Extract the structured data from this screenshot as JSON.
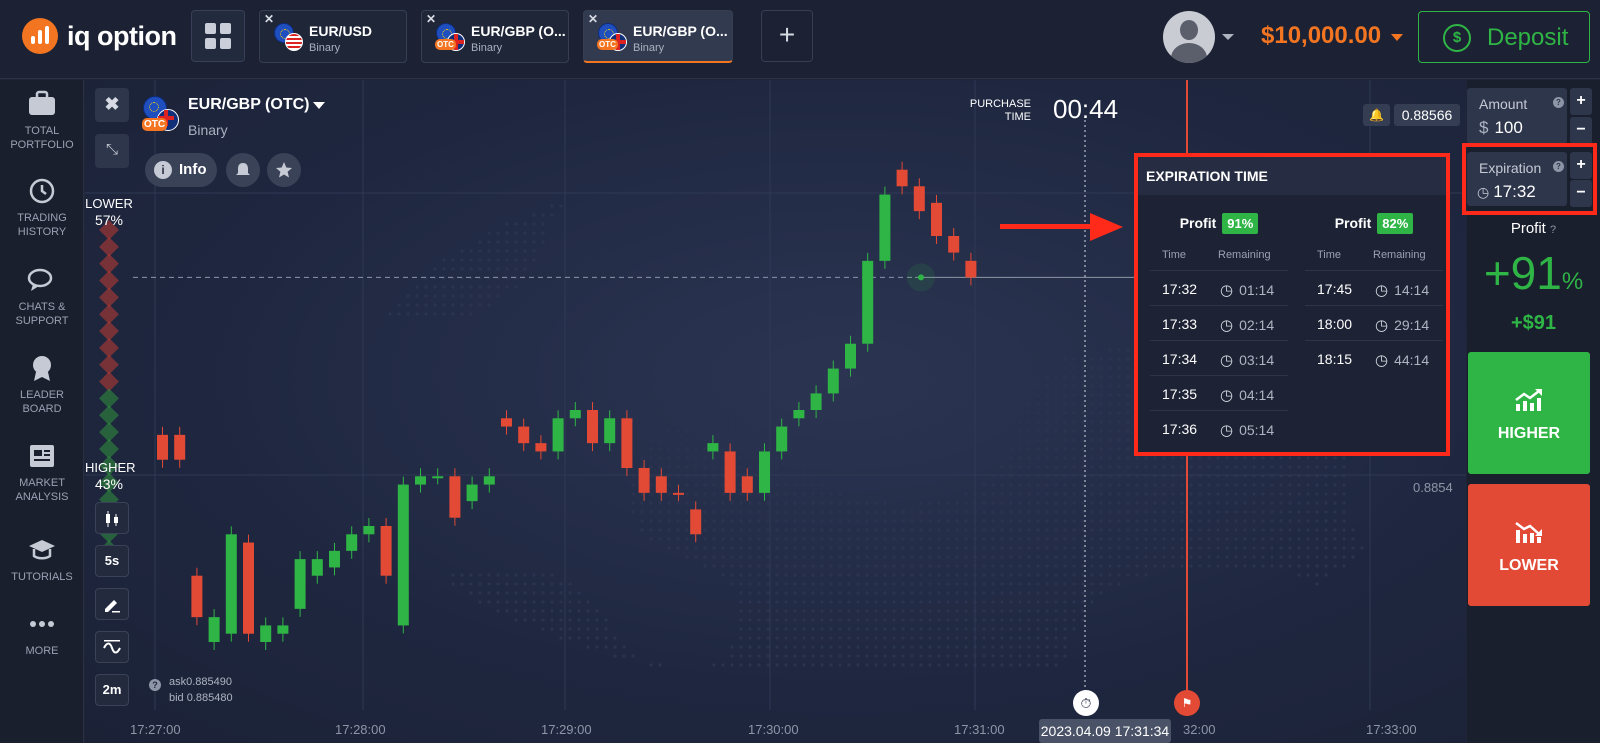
{
  "app": {
    "brand": "iq option"
  },
  "header": {
    "tabs": [
      {
        "name": "EUR/USD",
        "type": "Binary",
        "flag": "eu-us"
      },
      {
        "name": "EUR/GBP (O...",
        "type": "Binary",
        "flag": "eu-uk-otc"
      },
      {
        "name": "EUR/GBP (O...",
        "type": "Binary",
        "flag": "eu-uk-otc",
        "active": true
      }
    ],
    "otc_badge": "OTC",
    "balance": "$10,000.00",
    "deposit_label": "Deposit",
    "add_tab": "+",
    "deposit_icon": "$"
  },
  "sidebar": {
    "items": [
      {
        "label": "TOTAL PORTFOLIO",
        "icon": "briefcase-icon"
      },
      {
        "label": "TRADING HISTORY",
        "icon": "history-icon"
      },
      {
        "label": "CHATS & SUPPORT",
        "icon": "chat-icon"
      },
      {
        "label": "LEADER BOARD",
        "icon": "medal-icon"
      },
      {
        "label": "MARKET ANALYSIS",
        "icon": "newspaper-icon"
      },
      {
        "label": "TUTORIALS",
        "icon": "graduation-cap-icon"
      },
      {
        "label": "MORE",
        "icon": "more-dots-icon"
      }
    ]
  },
  "chart": {
    "asset": "EUR/GBP (OTC)",
    "type": "Binary",
    "info_label": "Info",
    "purchase_time_label": "PURCHASE TIME",
    "purchase_time": "00:44",
    "current_price": "0.88566",
    "axis_price": "0.8854",
    "sentiment": {
      "lower_label": "LOWER",
      "lower_pct": "57%",
      "higher_label": "HIGHER",
      "higher_pct": "43%",
      "lower_fraction": 0.57
    },
    "tools": {
      "timeframe": "5s",
      "period": "2m"
    },
    "ask": "ask0.885490",
    "bid": "bid 0.885480",
    "time_labels": [
      "17:27:00",
      "17:28:00",
      "17:29:00",
      "17:30:00",
      "17:31:00",
      "32:00",
      "17:33:00"
    ],
    "time_badge": "2023.04.09 17:31:34",
    "help_glyph": "?",
    "close_glyph": "✖",
    "minimize_glyph": "⤡"
  },
  "chart_data": {
    "type": "candlestick",
    "candles": [
      [
        "r",
        0.88547,
        0.88544
      ],
      [
        "r",
        0.88547,
        0.88544
      ],
      [
        "r",
        0.8853,
        0.88525
      ],
      [
        "g",
        0.88522,
        0.88525
      ],
      [
        "g",
        0.88523,
        0.88535
      ],
      [
        "r",
        0.88534,
        0.88523
      ],
      [
        "g",
        0.88522,
        0.88524
      ],
      [
        "g",
        0.88523,
        0.88524
      ],
      [
        "g",
        0.88526,
        0.88532
      ],
      [
        "g",
        0.8853,
        0.88532
      ],
      [
        "g",
        0.88531,
        0.88533
      ],
      [
        "g",
        0.88533,
        0.88535
      ],
      [
        "g",
        0.88535,
        0.88536
      ],
      [
        "r",
        0.88536,
        0.8853
      ],
      [
        "g",
        0.88524,
        0.88541
      ],
      [
        "g",
        0.88541,
        0.88542
      ],
      [
        "g",
        0.88542,
        0.88542
      ],
      [
        "r",
        0.88542,
        0.88537
      ],
      [
        "g",
        0.88539,
        0.88541
      ],
      [
        "g",
        0.88541,
        0.88542
      ],
      [
        "r",
        0.88549,
        0.88548
      ],
      [
        "r",
        0.88548,
        0.88546
      ],
      [
        "r",
        0.88546,
        0.88545
      ],
      [
        "g",
        0.88545,
        0.88549
      ],
      [
        "g",
        0.88549,
        0.8855
      ],
      [
        "r",
        0.8855,
        0.88546
      ],
      [
        "g",
        0.88546,
        0.88549
      ],
      [
        "r",
        0.88549,
        0.88543
      ],
      [
        "r",
        0.88543,
        0.8854
      ],
      [
        "r",
        0.88542,
        0.8854
      ],
      [
        "r",
        0.8854,
        0.8854
      ],
      [
        "r",
        0.88538,
        0.88535
      ],
      [
        "g",
        0.88545,
        0.88546
      ],
      [
        "r",
        0.88545,
        0.8854
      ],
      [
        "r",
        0.88542,
        0.8854
      ],
      [
        "g",
        0.8854,
        0.88545
      ],
      [
        "g",
        0.88545,
        0.88548
      ],
      [
        "g",
        0.88549,
        0.8855
      ],
      [
        "g",
        0.8855,
        0.88552
      ],
      [
        "g",
        0.88552,
        0.88555
      ],
      [
        "g",
        0.88555,
        0.88558
      ],
      [
        "g",
        0.88558,
        0.88568
      ],
      [
        "g",
        0.88568,
        0.88576
      ],
      [
        "r",
        0.88579,
        0.88577
      ],
      [
        "r",
        0.88577,
        0.88574
      ],
      [
        "r",
        0.88575,
        0.88571
      ],
      [
        "r",
        0.88571,
        0.88569
      ],
      [
        "r",
        0.88568,
        0.88566
      ]
    ],
    "current_price": 0.88566,
    "ylim": [
      0.88515,
      0.88585
    ]
  },
  "expiration": {
    "title": "EXPIRATION TIME",
    "profit_label": "Profit",
    "col_time": "Time",
    "col_remaining": "Remaining",
    "columns": [
      {
        "profit": "91%",
        "rows": [
          {
            "time": "17:32",
            "remaining": "01:14"
          },
          {
            "time": "17:33",
            "remaining": "02:14"
          },
          {
            "time": "17:34",
            "remaining": "03:14"
          },
          {
            "time": "17:35",
            "remaining": "04:14"
          },
          {
            "time": "17:36",
            "remaining": "05:14"
          }
        ]
      },
      {
        "profit": "82%",
        "rows": [
          {
            "time": "17:45",
            "remaining": "14:14"
          },
          {
            "time": "18:00",
            "remaining": "29:14"
          },
          {
            "time": "18:15",
            "remaining": "44:14"
          }
        ]
      }
    ]
  },
  "trade": {
    "amount_label": "Amount",
    "currency": "$",
    "amount": "100",
    "expiration_label": "Expiration",
    "expiration_value": "17:32",
    "profit_label": "Profit",
    "profit_pct": "+91",
    "profit_pct_unit": "%",
    "profit_cash": "+$91",
    "higher_label": "HIGHER",
    "lower_label": "LOWER",
    "plus": "+",
    "minus": "−",
    "clock_glyph": "◷",
    "help_glyph": "?"
  },
  "colors": {
    "accent": "#f47521",
    "green": "#2fb545",
    "red": "#e24a35",
    "highlight": "#ff2a1a"
  }
}
